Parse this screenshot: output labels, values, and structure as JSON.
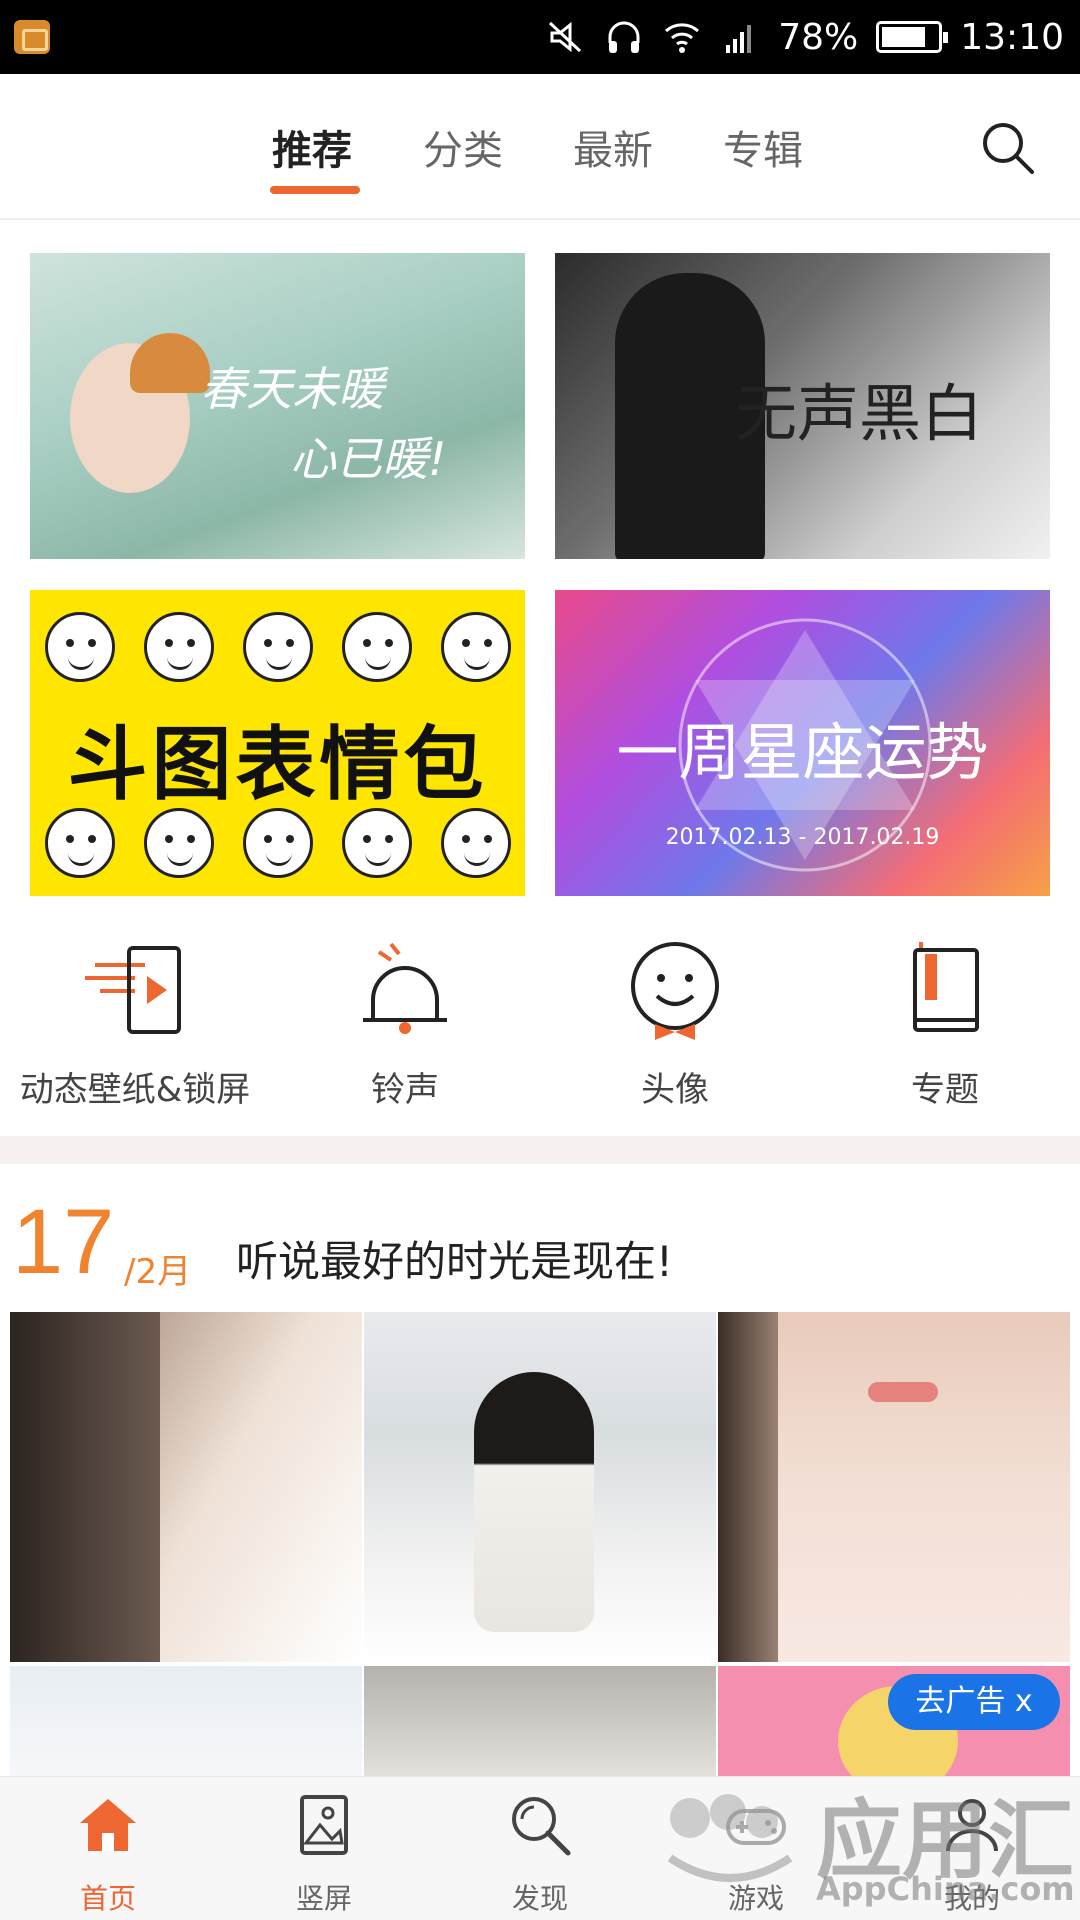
{
  "status_bar": {
    "battery_percent": "78%",
    "time": "13:10",
    "icons": [
      "app-icon",
      "mute-icon",
      "headphones-icon",
      "wifi-icon",
      "signal-icon",
      "battery-icon"
    ]
  },
  "top_tabs": [
    {
      "label": "推荐",
      "active": true
    },
    {
      "label": "分类",
      "active": false
    },
    {
      "label": "最新",
      "active": false
    },
    {
      "label": "专辑",
      "active": false
    }
  ],
  "banners": [
    {
      "text_line1": "春天未暖",
      "text_line2": "心已暖!"
    },
    {
      "text": "无声黑白"
    },
    {
      "text": "斗图表情包"
    },
    {
      "text": "一周星座运势",
      "date": "2017.02.13 - 2017.02.19"
    }
  ],
  "categories": [
    {
      "label": "动态壁纸&锁屏",
      "icon": "live-wallpaper-icon"
    },
    {
      "label": "铃声",
      "icon": "bell-icon"
    },
    {
      "label": "头像",
      "icon": "avatar-face-icon"
    },
    {
      "label": "专题",
      "icon": "book-icon"
    }
  ],
  "daily": {
    "day": "17",
    "month": "/2月",
    "headline": "听说最好的时光是现在!"
  },
  "ad_close": {
    "label": "去广告 x"
  },
  "bottom_nav": [
    {
      "label": "首页",
      "icon": "home-icon",
      "active": true
    },
    {
      "label": "竖屏",
      "icon": "picture-icon",
      "active": false
    },
    {
      "label": "发现",
      "icon": "search-icon",
      "active": false
    },
    {
      "label": "游戏",
      "icon": "gamepad-icon",
      "active": false
    },
    {
      "label": "我的",
      "icon": "user-icon",
      "active": false
    }
  ],
  "watermark": {
    "title": "应用汇",
    "subtitle": "AppChina.com"
  },
  "colors": {
    "accent": "#ee6630",
    "daily_orange": "#f0832e",
    "ad_blue": "#1a74e8",
    "banner_yellow": "#ffe600"
  }
}
